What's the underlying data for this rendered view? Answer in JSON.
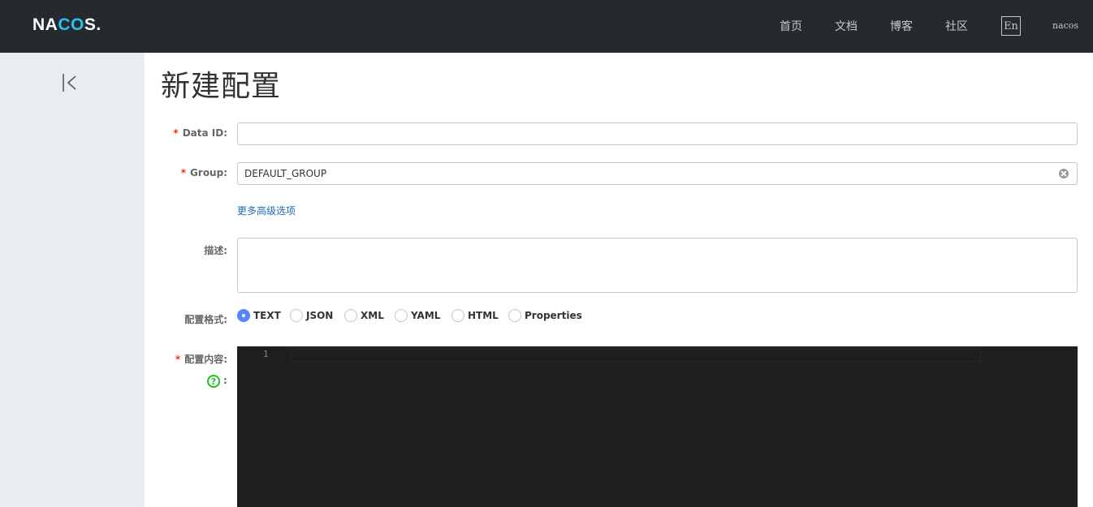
{
  "header": {
    "logo": {
      "prefix": "NA",
      "accent": "CO",
      "suffix": "S."
    },
    "nav": [
      "首页",
      "文档",
      "博客",
      "社区"
    ],
    "lang_button": "En",
    "username": "nacos"
  },
  "sidebar": {
    "collapse_icon": "collapse-left-icon"
  },
  "page": {
    "title": "新建配置"
  },
  "form": {
    "required_mark": "*",
    "data_id": {
      "label": "Data ID:",
      "value": ""
    },
    "group": {
      "label": "Group:",
      "value": "DEFAULT_GROUP"
    },
    "advanced_link": "更多高级选项",
    "description": {
      "label": "描述:",
      "value": ""
    },
    "format": {
      "label": "配置格式:",
      "options": [
        "TEXT",
        "JSON",
        "XML",
        "YAML",
        "HTML",
        "Properties"
      ],
      "selected": "TEXT"
    },
    "content": {
      "label": "配置内容:",
      "help_colon": ":",
      "help_icon": "question-icon"
    }
  },
  "editor": {
    "line_numbers": [
      "1"
    ]
  },
  "colors": {
    "topbar": "#252a2f",
    "sidebar": "#e9edf0",
    "accent": "#5584ff",
    "link": "#1e6bb8",
    "required": "#ff3000",
    "editor_bg": "#1e1e1e",
    "help": "#1dc11d"
  }
}
